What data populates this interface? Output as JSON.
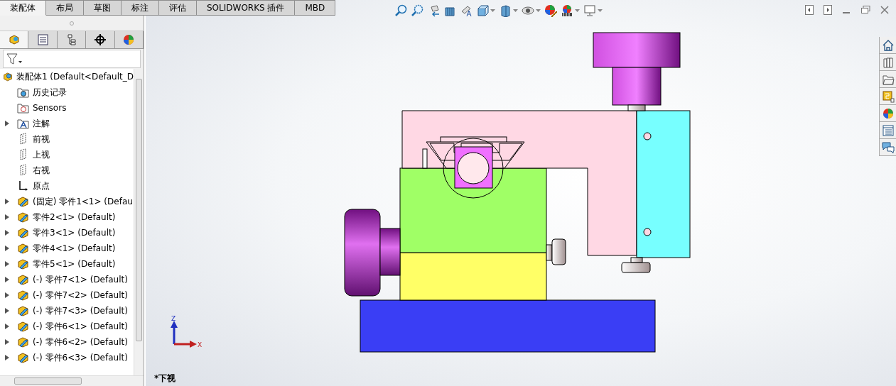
{
  "command_tabs": [
    {
      "label": "装配体",
      "selected": true
    },
    {
      "label": "布局",
      "selected": false
    },
    {
      "label": "草图",
      "selected": false
    },
    {
      "label": "标注",
      "selected": false
    },
    {
      "label": "评估",
      "selected": false
    },
    {
      "label": "SOLIDWORKS 插件",
      "selected": false
    },
    {
      "label": "MBD",
      "selected": false
    }
  ],
  "panel_tabs": [
    {
      "kind": "feature-manager",
      "selected": true
    },
    {
      "kind": "property-manager",
      "selected": false
    },
    {
      "kind": "configuration-manager",
      "selected": false
    },
    {
      "kind": "dimxpert",
      "selected": false
    },
    {
      "kind": "display-manager",
      "selected": false
    }
  ],
  "feature_tree": {
    "root": "装配体1  (Default<Default_D",
    "items": [
      {
        "kind": "history",
        "label": "历史记录",
        "expandable": false
      },
      {
        "kind": "sensors",
        "label": "Sensors",
        "expandable": false
      },
      {
        "kind": "annotations",
        "label": "注解",
        "expandable": true
      },
      {
        "kind": "plane",
        "label": "前视",
        "expandable": false
      },
      {
        "kind": "plane",
        "label": "上视",
        "expandable": false
      },
      {
        "kind": "plane",
        "label": "右视",
        "expandable": false
      },
      {
        "kind": "origin",
        "label": "原点",
        "expandable": false
      },
      {
        "kind": "part",
        "label": "(固定) 零件1<1> (Defau",
        "expandable": true
      },
      {
        "kind": "part",
        "label": "零件2<1> (Default)",
        "expandable": true
      },
      {
        "kind": "part",
        "label": "零件3<1> (Default)",
        "expandable": true
      },
      {
        "kind": "part",
        "label": "零件4<1> (Default)",
        "expandable": true
      },
      {
        "kind": "part",
        "label": "零件5<1> (Default)",
        "expandable": true
      },
      {
        "kind": "part",
        "label": "(-) 零件7<1> (Default)",
        "expandable": true
      },
      {
        "kind": "part",
        "label": "(-) 零件7<2> (Default)",
        "expandable": true
      },
      {
        "kind": "part",
        "label": "(-) 零件7<3> (Default)",
        "expandable": true
      },
      {
        "kind": "part",
        "label": "(-) 零件6<1> (Default)",
        "expandable": true
      },
      {
        "kind": "part",
        "label": "(-) 零件6<2> (Default)",
        "expandable": true
      },
      {
        "kind": "part",
        "label": "(-) 零件6<3> (Default)",
        "expandable": true
      }
    ]
  },
  "view_toolbar": [
    {
      "kind": "zoom-to-fit",
      "dropdown": false
    },
    {
      "kind": "zoom-to-area",
      "dropdown": false
    },
    {
      "kind": "previous-view",
      "dropdown": false
    },
    {
      "kind": "section-view",
      "dropdown": false
    },
    {
      "kind": "dynamic-annotation",
      "dropdown": false
    },
    {
      "kind": "view-orientation",
      "dropdown": true
    },
    {
      "kind": "display-style",
      "dropdown": true
    },
    {
      "kind": "hide-show",
      "dropdown": true
    },
    {
      "kind": "edit-appearance",
      "dropdown": false
    },
    {
      "kind": "apply-scene",
      "dropdown": true
    },
    {
      "kind": "view-settings",
      "dropdown": true
    }
  ],
  "task_pane": [
    {
      "kind": "home"
    },
    {
      "kind": "design-library"
    },
    {
      "kind": "file-explorer"
    },
    {
      "kind": "view-palette"
    },
    {
      "kind": "appearances"
    },
    {
      "kind": "custom-properties"
    },
    {
      "kind": "forum"
    }
  ],
  "triad": {
    "z_label": "Z",
    "x_label": "X"
  },
  "view_name": "*下视"
}
